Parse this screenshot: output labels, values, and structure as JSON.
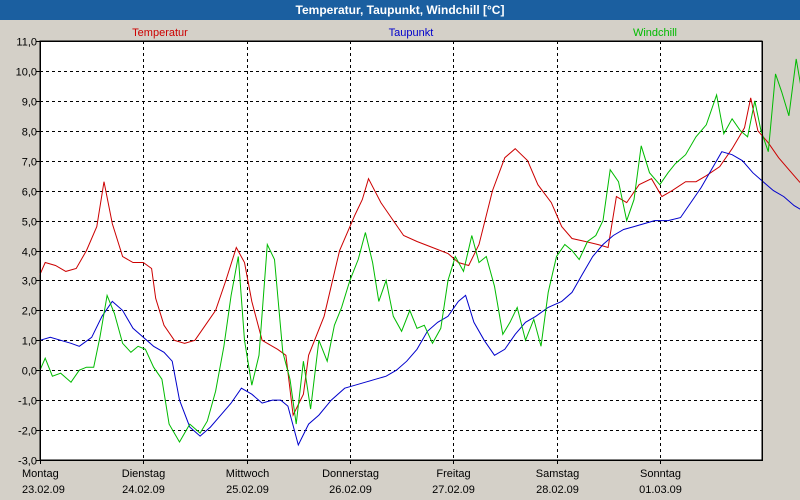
{
  "window": {
    "title": "Temperatur, Taupunkt, Windchill [°C]"
  },
  "colors": {
    "background": "#d4d0c8",
    "plot": "#ffffff",
    "titlebar": "#1b5fa0",
    "grid": "#000000"
  },
  "chart_data": {
    "type": "line",
    "title": "Temperatur, Taupunkt, Windchill [°C]",
    "xlabel": "",
    "ylabel": "",
    "grid": true,
    "legend_position": "top",
    "ylim": [
      -3.0,
      11.0
    ],
    "y_ticks": [
      -3.0,
      -2.0,
      -1.0,
      0.0,
      1.0,
      2.0,
      3.0,
      4.0,
      5.0,
      6.0,
      7.0,
      8.0,
      9.0,
      10.0,
      11.0
    ],
    "y_tick_labels": [
      "-3,0",
      "-2,0",
      "-1,0",
      "0,0",
      "1,0",
      "2,0",
      "3,0",
      "4,0",
      "5,0",
      "6,0",
      "7,0",
      "8,0",
      "9,0",
      "10,0",
      "11,0"
    ],
    "xlim": [
      0,
      7.4
    ],
    "x_ticks": [
      {
        "day": "Montag",
        "date": "23.02.09",
        "x": 0
      },
      {
        "day": "Dienstag",
        "date": "24.02.09",
        "x": 1
      },
      {
        "day": "Mittwoch",
        "date": "25.02.09",
        "x": 2
      },
      {
        "day": "Donnerstag",
        "date": "26.02.09",
        "x": 3
      },
      {
        "day": "Freitag",
        "date": "27.02.09",
        "x": 4
      },
      {
        "day": "Samstag",
        "date": "28.02.09",
        "x": 5
      },
      {
        "day": "Sonntag",
        "date": "01.03.09",
        "x": 6
      }
    ],
    "series": [
      {
        "name": "Temperatur",
        "color": "#cc0000",
        "points": [
          [
            0,
            3.2
          ],
          [
            0.05,
            3.6
          ],
          [
            0.15,
            3.5
          ],
          [
            0.25,
            3.3
          ],
          [
            0.35,
            3.4
          ],
          [
            0.45,
            4.0
          ],
          [
            0.55,
            4.8
          ],
          [
            0.62,
            6.3
          ],
          [
            0.7,
            4.9
          ],
          [
            0.8,
            3.8
          ],
          [
            0.9,
            3.6
          ],
          [
            1.0,
            3.6
          ],
          [
            1.08,
            3.4
          ],
          [
            1.12,
            2.4
          ],
          [
            1.2,
            1.5
          ],
          [
            1.3,
            1.0
          ],
          [
            1.4,
            0.9
          ],
          [
            1.5,
            1.0
          ],
          [
            1.6,
            1.5
          ],
          [
            1.7,
            2.0
          ],
          [
            1.8,
            3.0
          ],
          [
            1.9,
            4.1
          ],
          [
            1.98,
            3.6
          ],
          [
            2.05,
            2.3
          ],
          [
            2.15,
            1.0
          ],
          [
            2.25,
            0.8
          ],
          [
            2.3,
            0.7
          ],
          [
            2.38,
            0.5
          ],
          [
            2.45,
            -1.5
          ],
          [
            2.55,
            -0.8
          ],
          [
            2.6,
            0.5
          ],
          [
            2.75,
            1.8
          ],
          [
            2.9,
            4.0
          ],
          [
            3.05,
            5.2
          ],
          [
            3.12,
            5.7
          ],
          [
            3.18,
            6.4
          ],
          [
            3.3,
            5.6
          ],
          [
            3.42,
            5.0
          ],
          [
            3.52,
            4.5
          ],
          [
            3.65,
            4.3
          ],
          [
            3.8,
            4.1
          ],
          [
            3.95,
            3.9
          ],
          [
            4.05,
            3.6
          ],
          [
            4.15,
            3.5
          ],
          [
            4.25,
            4.2
          ],
          [
            4.38,
            6.0
          ],
          [
            4.5,
            7.1
          ],
          [
            4.6,
            7.4
          ],
          [
            4.72,
            7.0
          ],
          [
            4.82,
            6.2
          ],
          [
            4.95,
            5.6
          ],
          [
            5.05,
            4.8
          ],
          [
            5.15,
            4.4
          ],
          [
            5.28,
            4.3
          ],
          [
            5.4,
            4.2
          ],
          [
            5.5,
            4.1
          ],
          [
            5.58,
            5.8
          ],
          [
            5.68,
            5.6
          ],
          [
            5.8,
            6.2
          ],
          [
            5.92,
            6.4
          ],
          [
            6.02,
            5.8
          ],
          [
            6.12,
            6.0
          ],
          [
            6.25,
            6.3
          ],
          [
            6.35,
            6.3
          ],
          [
            6.45,
            6.5
          ],
          [
            6.58,
            6.8
          ],
          [
            6.7,
            7.4
          ],
          [
            6.82,
            8.1
          ],
          [
            6.88,
            9.1
          ],
          [
            6.95,
            8.0
          ],
          [
            7.05,
            7.6
          ],
          [
            7.15,
            7.1
          ],
          [
            7.25,
            6.7
          ],
          [
            7.35,
            6.3
          ],
          [
            7.45,
            6.0
          ],
          [
            7.55,
            6.2
          ],
          [
            7.65,
            6.5
          ],
          [
            7.75,
            7.5
          ],
          [
            7.85,
            8.3
          ],
          [
            7.95,
            8.3
          ],
          [
            8.05,
            8.0
          ],
          [
            8.15,
            7.9
          ],
          [
            8.22,
            5.3
          ],
          [
            8.3,
            4.9
          ],
          [
            8.36,
            5.4
          ],
          [
            8.42,
            5.0
          ]
        ]
      },
      {
        "name": "Taupunkt",
        "color": "#0000cc",
        "points": [
          [
            0,
            1.0
          ],
          [
            0.1,
            1.1
          ],
          [
            0.2,
            1.0
          ],
          [
            0.3,
            0.9
          ],
          [
            0.38,
            0.8
          ],
          [
            0.5,
            1.1
          ],
          [
            0.6,
            1.8
          ],
          [
            0.7,
            2.3
          ],
          [
            0.8,
            2.0
          ],
          [
            0.9,
            1.4
          ],
          [
            1.0,
            1.1
          ],
          [
            1.1,
            0.8
          ],
          [
            1.2,
            0.6
          ],
          [
            1.28,
            0.3
          ],
          [
            1.35,
            -1.0
          ],
          [
            1.45,
            -1.9
          ],
          [
            1.55,
            -2.2
          ],
          [
            1.65,
            -1.9
          ],
          [
            1.75,
            -1.5
          ],
          [
            1.85,
            -1.1
          ],
          [
            1.95,
            -0.6
          ],
          [
            2.05,
            -0.8
          ],
          [
            2.15,
            -1.1
          ],
          [
            2.25,
            -1.0
          ],
          [
            2.33,
            -1.0
          ],
          [
            2.4,
            -1.2
          ],
          [
            2.5,
            -2.5
          ],
          [
            2.6,
            -1.8
          ],
          [
            2.7,
            -1.5
          ],
          [
            2.82,
            -1.0
          ],
          [
            2.95,
            -0.6
          ],
          [
            3.05,
            -0.5
          ],
          [
            3.15,
            -0.4
          ],
          [
            3.25,
            -0.3
          ],
          [
            3.35,
            -0.2
          ],
          [
            3.45,
            0.0
          ],
          [
            3.55,
            0.3
          ],
          [
            3.65,
            0.7
          ],
          [
            3.75,
            1.3
          ],
          [
            3.85,
            1.6
          ],
          [
            3.95,
            1.8
          ],
          [
            4.05,
            2.3
          ],
          [
            4.12,
            2.5
          ],
          [
            4.2,
            1.6
          ],
          [
            4.3,
            1.0
          ],
          [
            4.4,
            0.5
          ],
          [
            4.5,
            0.7
          ],
          [
            4.6,
            1.2
          ],
          [
            4.7,
            1.6
          ],
          [
            4.8,
            1.8
          ],
          [
            4.92,
            2.1
          ],
          [
            5.05,
            2.3
          ],
          [
            5.15,
            2.6
          ],
          [
            5.25,
            3.2
          ],
          [
            5.35,
            3.8
          ],
          [
            5.45,
            4.2
          ],
          [
            5.55,
            4.5
          ],
          [
            5.65,
            4.7
          ],
          [
            5.75,
            4.8
          ],
          [
            5.85,
            4.9
          ],
          [
            5.95,
            5.0
          ],
          [
            6.08,
            5.0
          ],
          [
            6.2,
            5.1
          ],
          [
            6.3,
            5.6
          ],
          [
            6.4,
            6.1
          ],
          [
            6.5,
            6.7
          ],
          [
            6.6,
            7.3
          ],
          [
            6.7,
            7.2
          ],
          [
            6.8,
            7.0
          ],
          [
            6.9,
            6.6
          ],
          [
            7.0,
            6.3
          ],
          [
            7.1,
            6.0
          ],
          [
            7.2,
            5.8
          ],
          [
            7.3,
            5.5
          ],
          [
            7.4,
            5.3
          ],
          [
            7.5,
            5.2
          ],
          [
            7.6,
            5.5
          ],
          [
            7.7,
            6.0
          ],
          [
            7.8,
            5.8
          ],
          [
            7.9,
            5.6
          ],
          [
            8.0,
            5.4
          ],
          [
            8.1,
            5.0
          ],
          [
            8.2,
            4.2
          ],
          [
            8.3,
            3.7
          ],
          [
            8.38,
            3.6
          ],
          [
            8.42,
            3.4
          ]
        ]
      },
      {
        "name": "Windchill",
        "color": "#00bb00",
        "points": [
          [
            0,
            0.0
          ],
          [
            0.05,
            0.4
          ],
          [
            0.12,
            -0.2
          ],
          [
            0.2,
            -0.1
          ],
          [
            0.3,
            -0.4
          ],
          [
            0.38,
            0.0
          ],
          [
            0.45,
            0.1
          ],
          [
            0.52,
            0.1
          ],
          [
            0.58,
            1.1
          ],
          [
            0.65,
            2.5
          ],
          [
            0.72,
            1.9
          ],
          [
            0.8,
            0.9
          ],
          [
            0.88,
            0.6
          ],
          [
            0.95,
            0.8
          ],
          [
            1.02,
            0.7
          ],
          [
            1.1,
            0.1
          ],
          [
            1.18,
            -0.3
          ],
          [
            1.25,
            -1.8
          ],
          [
            1.35,
            -2.4
          ],
          [
            1.45,
            -1.8
          ],
          [
            1.55,
            -2.1
          ],
          [
            1.62,
            -1.7
          ],
          [
            1.7,
            -0.7
          ],
          [
            1.78,
            0.8
          ],
          [
            1.85,
            2.5
          ],
          [
            1.92,
            3.8
          ],
          [
            1.98,
            1.0
          ],
          [
            2.05,
            -0.5
          ],
          [
            2.12,
            0.5
          ],
          [
            2.2,
            4.2
          ],
          [
            2.27,
            3.7
          ],
          [
            2.35,
            0.6
          ],
          [
            2.42,
            -0.3
          ],
          [
            2.48,
            -1.8
          ],
          [
            2.55,
            0.3
          ],
          [
            2.62,
            -1.3
          ],
          [
            2.7,
            1.0
          ],
          [
            2.78,
            0.3
          ],
          [
            2.85,
            1.5
          ],
          [
            2.92,
            2.1
          ],
          [
            3.0,
            3.0
          ],
          [
            3.08,
            3.7
          ],
          [
            3.15,
            4.6
          ],
          [
            3.22,
            3.6
          ],
          [
            3.28,
            2.3
          ],
          [
            3.35,
            3.0
          ],
          [
            3.42,
            1.8
          ],
          [
            3.5,
            1.3
          ],
          [
            3.58,
            2.0
          ],
          [
            3.65,
            1.4
          ],
          [
            3.72,
            1.5
          ],
          [
            3.8,
            0.9
          ],
          [
            3.88,
            1.4
          ],
          [
            3.95,
            3.0
          ],
          [
            4.02,
            3.8
          ],
          [
            4.1,
            3.3
          ],
          [
            4.18,
            4.5
          ],
          [
            4.25,
            3.6
          ],
          [
            4.32,
            3.8
          ],
          [
            4.4,
            2.8
          ],
          [
            4.48,
            1.2
          ],
          [
            4.55,
            1.6
          ],
          [
            4.62,
            2.1
          ],
          [
            4.7,
            1.0
          ],
          [
            4.78,
            1.7
          ],
          [
            4.85,
            0.8
          ],
          [
            4.92,
            2.6
          ],
          [
            5.0,
            3.8
          ],
          [
            5.08,
            4.2
          ],
          [
            5.15,
            4.0
          ],
          [
            5.22,
            3.7
          ],
          [
            5.3,
            4.3
          ],
          [
            5.38,
            4.5
          ],
          [
            5.45,
            5.0
          ],
          [
            5.52,
            6.7
          ],
          [
            5.6,
            6.3
          ],
          [
            5.68,
            5.0
          ],
          [
            5.75,
            5.7
          ],
          [
            5.82,
            7.5
          ],
          [
            5.9,
            6.6
          ],
          [
            6.0,
            6.2
          ],
          [
            6.08,
            6.6
          ],
          [
            6.15,
            6.9
          ],
          [
            6.25,
            7.2
          ],
          [
            6.35,
            7.8
          ],
          [
            6.45,
            8.2
          ],
          [
            6.55,
            9.2
          ],
          [
            6.62,
            7.9
          ],
          [
            6.7,
            8.4
          ],
          [
            6.78,
            8.0
          ],
          [
            6.85,
            7.8
          ],
          [
            6.92,
            9.0
          ],
          [
            6.98,
            8.0
          ],
          [
            7.05,
            7.3
          ],
          [
            7.12,
            9.9
          ],
          [
            7.18,
            9.3
          ],
          [
            7.25,
            8.5
          ],
          [
            7.32,
            10.4
          ],
          [
            7.4,
            8.8
          ],
          [
            7.48,
            9.7
          ],
          [
            7.55,
            8.0
          ],
          [
            7.62,
            6.7
          ],
          [
            7.72,
            7.0
          ],
          [
            7.82,
            6.5
          ],
          [
            7.9,
            6.9
          ],
          [
            7.96,
            7.7
          ],
          [
            8.05,
            6.2
          ],
          [
            8.12,
            5.3
          ],
          [
            8.2,
            5.1
          ],
          [
            8.28,
            5.4
          ],
          [
            8.34,
            6.7
          ],
          [
            8.42,
            6.0
          ]
        ]
      }
    ]
  }
}
